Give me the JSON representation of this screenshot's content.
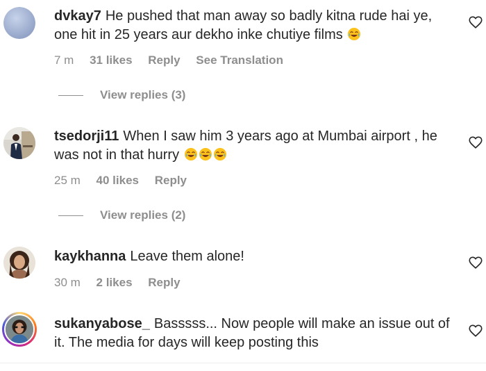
{
  "comments": [
    {
      "username": "dvkay7",
      "text": "He pushed that man away so badly kitna rude hai ye, one hit in 25 years aur dekho inke chutiye films",
      "emoji": "😂",
      "time": "7 m",
      "likes": "31 likes",
      "reply": "Reply",
      "translation": "See Translation",
      "view_replies": "View replies (3)"
    },
    {
      "username": "tsedorji11",
      "text": "When I saw him 3 years ago at Mumbai airport , he was not in that hurry",
      "emoji": "😂😂😂",
      "time": "25 m",
      "likes": "40 likes",
      "reply": "Reply",
      "view_replies": "View replies (2)"
    },
    {
      "username": "kaykhanna",
      "text": "Leave them alone!",
      "time": "30 m",
      "likes": "2 likes",
      "reply": "Reply"
    },
    {
      "username": "sukanyabose_",
      "text": "Basssss... Now people will make an issue out of it. The media for days will keep posting this"
    }
  ],
  "colors": {
    "text": "#262626",
    "meta": "#8e8e8e",
    "story_ring": [
      "#feda75",
      "#fa7e1e",
      "#d62976",
      "#962fbf",
      "#4f5bd5"
    ]
  },
  "icons": {
    "like": "heart-outline-icon",
    "emoji": "face-with-tears-of-joy"
  }
}
